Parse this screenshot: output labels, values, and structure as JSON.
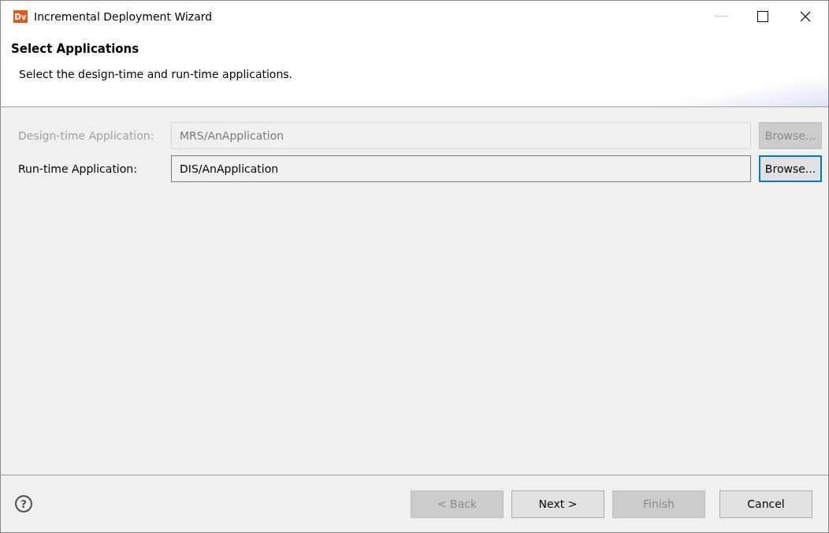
{
  "window": {
    "title": "Incremental Deployment Wizard",
    "app_icon": "Dv"
  },
  "header": {
    "title": "Select Applications",
    "description": "Select the design-time and run-time applications."
  },
  "fields": [
    {
      "label": "Design-time Application:",
      "value": "MRS/AnApplication",
      "disabled": true,
      "browse": {
        "label": "Browse...",
        "disabled": true,
        "focused": false
      }
    },
    {
      "label": "Run-time Application:",
      "value": "DIS/AnApplication",
      "disabled": false,
      "browse": {
        "label": "Browse...",
        "disabled": false,
        "focused": true
      }
    }
  ],
  "footer": {
    "help": "?",
    "buttons": [
      {
        "label": "< Back",
        "disabled": true
      },
      {
        "label": "Next >",
        "disabled": false
      },
      {
        "label": "Finish",
        "disabled": true
      },
      {
        "label": "Cancel",
        "disabled": false
      }
    ]
  }
}
